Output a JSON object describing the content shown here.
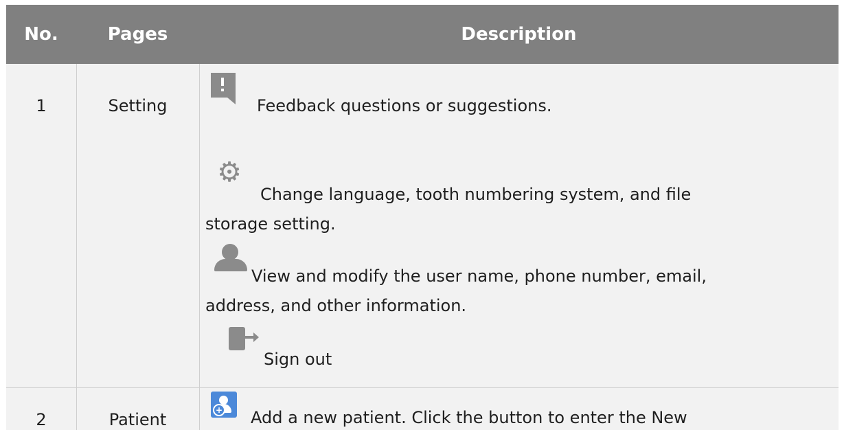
{
  "table": {
    "headers": {
      "no": "No.",
      "pages": "Pages",
      "description": "Description"
    },
    "rows": [
      {
        "no": "1",
        "page": "Setting",
        "items": [
          {
            "icon": "feedback-icon",
            "text": "Feedback questions or suggestions."
          },
          {
            "icon": "gear-icon",
            "text_line_1": "Change language, tooth numbering system, and file",
            "text_line_2": "storage setting."
          },
          {
            "icon": "user-icon",
            "text_line_1": "View and modify the user name, phone number, email,",
            "text_line_2": "address, and other information."
          },
          {
            "icon": "sign-out-icon",
            "text": "Sign out"
          }
        ]
      },
      {
        "no": "2",
        "page": "Patient",
        "items": [
          {
            "icon": "add-patient-icon",
            "text": "Add a new patient. Click the button to enter the New"
          }
        ]
      }
    ]
  }
}
